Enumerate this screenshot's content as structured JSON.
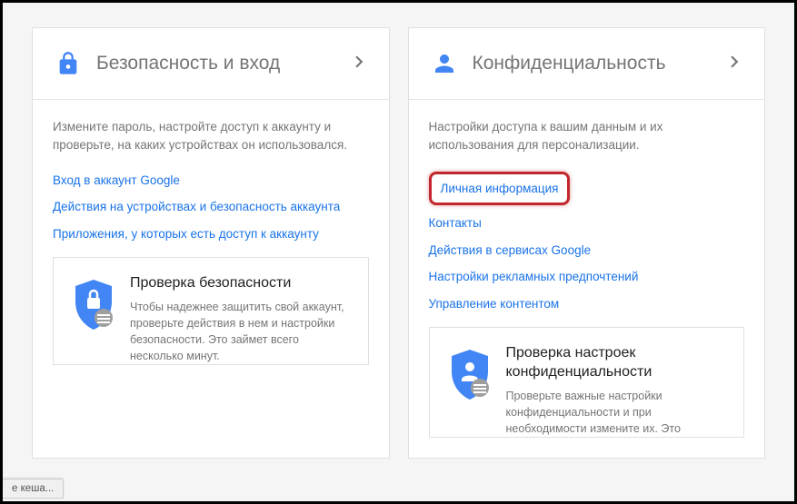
{
  "cards": [
    {
      "title": "Безопасность и вход",
      "desc": "Измените пароль, настройте доступ к аккаунту и проверьте, на каких устройствах он использовался.",
      "links": [
        {
          "text": "Вход в аккаунт Google",
          "highlighted": false
        },
        {
          "text": "Действия на устройствах и безопасность аккаунта",
          "highlighted": false
        },
        {
          "text": "Приложения, у которых есть доступ к аккаунту",
          "highlighted": false
        }
      ],
      "check": {
        "title": "Проверка безопасности",
        "desc": "Чтобы надежнее защитить свой аккаунт, проверьте действия в нем и настройки безопасности. Это займет всего несколько минут."
      }
    },
    {
      "title": "Конфиденциальность",
      "desc": "Настройки доступа к вашим данным и их использования для персонализации.",
      "links": [
        {
          "text": "Личная информация",
          "highlighted": true
        },
        {
          "text": "Контакты",
          "highlighted": false
        },
        {
          "text": "Действия в сервисах Google",
          "highlighted": false
        },
        {
          "text": "Настройки рекламных предпочтений",
          "highlighted": false
        },
        {
          "text": "Управление контентом",
          "highlighted": false
        }
      ],
      "check": {
        "title": "Проверка настроек конфиденциальности",
        "desc": "Проверьте важные настройки конфиденциальности и при необходимости измените их. Это"
      }
    }
  ],
  "status": "е кеша..."
}
